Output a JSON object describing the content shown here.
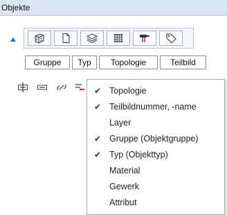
{
  "panel": {
    "title": "Objekte"
  },
  "toolbar": {
    "buttons": [
      {
        "icon": "wall-icon"
      },
      {
        "icon": "page-icon"
      },
      {
        "icon": "layers-icon"
      },
      {
        "icon": "grid-icon"
      },
      {
        "icon": "hammer-icon"
      },
      {
        "icon": "tag-icon"
      }
    ]
  },
  "filters": [
    "Gruppe",
    "Typ",
    "Topologie",
    "Teilbild"
  ],
  "actions": [
    {
      "icon": "expand-icon"
    },
    {
      "icon": "collapse-icon"
    },
    {
      "icon": "link-icon"
    },
    {
      "icon": "sort-icon"
    }
  ],
  "menu": {
    "items": [
      {
        "label": "Topologie",
        "checked": true,
        "check": "✔"
      },
      {
        "label": "Teilbildnummer, -name",
        "checked": true,
        "check": "✔"
      },
      {
        "label": "Layer",
        "checked": false,
        "check": ""
      },
      {
        "label": "Gruppe (Objektgruppe)",
        "checked": true,
        "check": "✔"
      },
      {
        "label": "Typ (Objekttyp)",
        "checked": true,
        "check": "✔"
      },
      {
        "label": "Material",
        "checked": false,
        "check": ""
      },
      {
        "label": "Gewerk",
        "checked": false,
        "check": ""
      },
      {
        "label": "Attribut",
        "checked": false,
        "check": ""
      }
    ]
  },
  "colors": {
    "header_bg": "#dbe5f2",
    "accent": "#1e6fc0"
  }
}
